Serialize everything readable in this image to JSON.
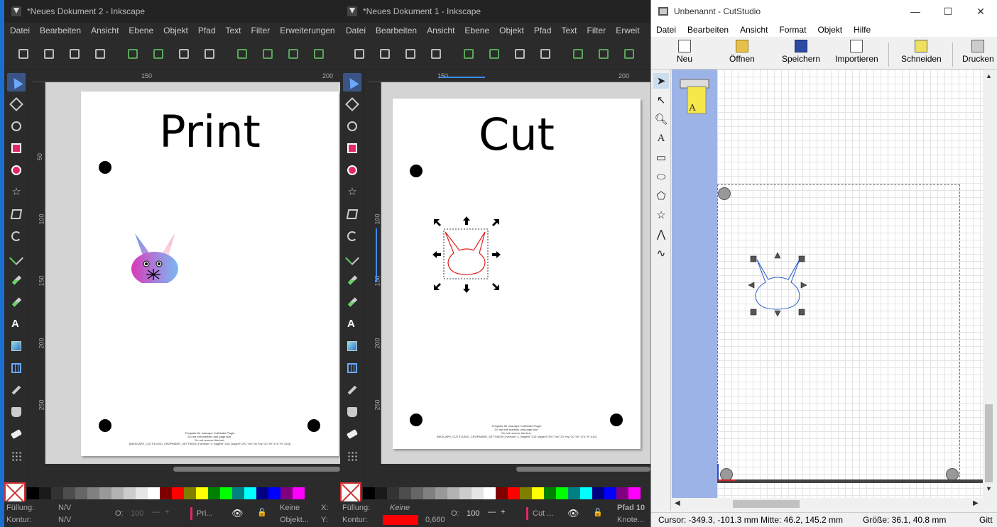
{
  "inkscape_left": {
    "title": "*Neues Dokument 2 - Inkscape",
    "menu": [
      "Datei",
      "Bearbeiten",
      "Ansicht",
      "Ebene",
      "Objekt",
      "Pfad",
      "Text",
      "Filter",
      "Erweiterungen"
    ],
    "ruler_ticks": [
      "150",
      "200"
    ],
    "ruler_v_ticks": [
      "50",
      "100",
      "150",
      "200",
      "250"
    ],
    "page_title": "Print",
    "template_text": [
      "Template für Inkscape CutStudio Plugin",
      "Do not edit markers and page size.",
      "Do not remove this text.",
      "{INKSCAPE_CUTSTUDIO_CROPMARK_SETTINGS={\"version\":1,\"pageW\":210,\"pageH\":297,\"mx\":20,\"my\":20,\"W\":170,\"H\":210}}"
    ],
    "status": {
      "fill_label": "Füllung:",
      "fill_value": "N/V",
      "stroke_label": "Kontur:",
      "stroke_value": "N/V",
      "opacity_label": "O:",
      "opacity_value": "100",
      "layer": "Pri...",
      "objects": "Keine",
      "objects2": "Objekt...",
      "x_label": "X:",
      "y_label": "Y:"
    }
  },
  "inkscape_right": {
    "title": "*Neues Dokument 1 - Inkscape",
    "menu": [
      "Datei",
      "Bearbeiten",
      "Ansicht",
      "Ebene",
      "Objekt",
      "Pfad",
      "Text",
      "Filter",
      "Erweit"
    ],
    "ruler_ticks": [
      "150",
      "200"
    ],
    "ruler_v_ticks": [
      "100",
      "150",
      "200",
      "250"
    ],
    "page_title": "Cut",
    "template_text": [
      "Template für Inkscape CutStudio Plugin",
      "Do not edit markers and page size.",
      "Do not remove this text.",
      "INKSCAPE_CUTSTUDIO_CROPMARK_SETTINGS={\"version\":1,\"pageW\":210,\"pageH\":297,\"mx\":20,\"my\":20,\"W\":170,\"H\":210}"
    ],
    "status": {
      "fill_label": "Füllung:",
      "fill_value": "Keine",
      "stroke_label": "Kontur:",
      "stroke_width": "0,660",
      "opacity_label": "O:",
      "opacity_value": "100",
      "layer": "Cut ...",
      "objects": "Pfad 10",
      "objects2": "Knote..."
    }
  },
  "cutstudio": {
    "title": "Unbenannt - CutStudio",
    "window_buttons": [
      "—",
      "☐",
      "✕"
    ],
    "menu": [
      "Datei",
      "Bearbeiten",
      "Ansicht",
      "Format",
      "Objekt",
      "Hilfe"
    ],
    "toolbar": [
      "Neu",
      "Öffnen",
      "Speichern",
      "Importieren",
      "Schneiden",
      "Drucken"
    ],
    "tools": [
      "select-tool",
      "node-tool",
      "zoom-tool",
      "text-tool",
      "rectangle-tool",
      "ellipse-tool",
      "polygon-tool",
      "star-tool",
      "polyline-tool",
      "curve-tool"
    ],
    "status": {
      "cursor": "Cursor: -349.3, -101.3 mm",
      "center": "Mitte: 46.2, 145.2 mm",
      "size": "Größe: 36.1, 40.8 mm",
      "grid": "Gitt"
    }
  },
  "palette": [
    "#000000",
    "#1a1a1a",
    "#333333",
    "#4d4d4d",
    "#666666",
    "#808080",
    "#999999",
    "#b3b3b3",
    "#cccccc",
    "#e6e6e6",
    "#ffffff",
    "#800000",
    "#ff0000",
    "#808000",
    "#ffff00",
    "#008000",
    "#00ff00",
    "#008080",
    "#00ffff",
    "#000080",
    "#0000ff",
    "#800080",
    "#ff00ff"
  ],
  "colors": {
    "accent": "#1a6fd2",
    "selection": "#3a5585",
    "stroke_red": "#ff0000",
    "cut_blue": "#2255cc"
  }
}
